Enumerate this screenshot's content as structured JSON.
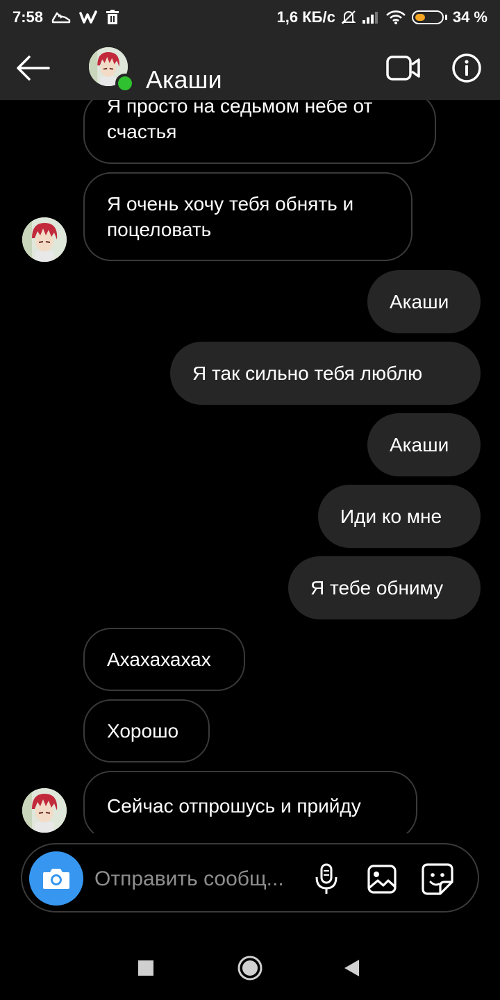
{
  "status_bar": {
    "time": "7:58",
    "network_speed": "1,6 КБ/с",
    "battery_percent": "34 %",
    "battery_level": 0.34,
    "icons": [
      "sneaker-icon",
      "w-app-icon",
      "trash-icon",
      "mute-bell-icon",
      "signal-icon",
      "wifi-icon",
      "battery-icon"
    ]
  },
  "header": {
    "contact_name": "Акаши",
    "online": true,
    "icons": [
      "back-arrow-icon",
      "video-call-icon",
      "info-icon"
    ]
  },
  "messages": [
    {
      "direction": "in",
      "text": "Я просто на седьмом небе от счастья"
    },
    {
      "direction": "in",
      "text": "Я очень хочу тебя обнять и поцеловать"
    },
    {
      "direction": "out",
      "text": "Акаши"
    },
    {
      "direction": "out",
      "text": "Я так сильно тебя люблю"
    },
    {
      "direction": "out",
      "text": "Акаши"
    },
    {
      "direction": "out",
      "text": "Иди ко мне"
    },
    {
      "direction": "out",
      "text": "Я тебе обниму"
    },
    {
      "direction": "in",
      "text": "Ахахахахах"
    },
    {
      "direction": "in",
      "text": "Хорошо"
    },
    {
      "direction": "in",
      "text": "Сейчас отпрошусь и прийду"
    }
  ],
  "composer": {
    "placeholder": "Отправить сообщ...",
    "icons": [
      "camera-icon",
      "microphone-icon",
      "gallery-icon",
      "sticker-icon"
    ]
  },
  "nav_bar": {
    "icons": [
      "recents-square-icon",
      "home-circle-icon",
      "back-triangle-icon"
    ]
  },
  "colors": {
    "background": "#000000",
    "bar": "#262626",
    "outgoing_bubble": "#262626",
    "incoming_border": "#3a3a3a",
    "accent_blue": "#3797f0",
    "online_green": "#2fc12f",
    "battery_fill": "#f5a623",
    "placeholder": "#8e8e8e"
  }
}
